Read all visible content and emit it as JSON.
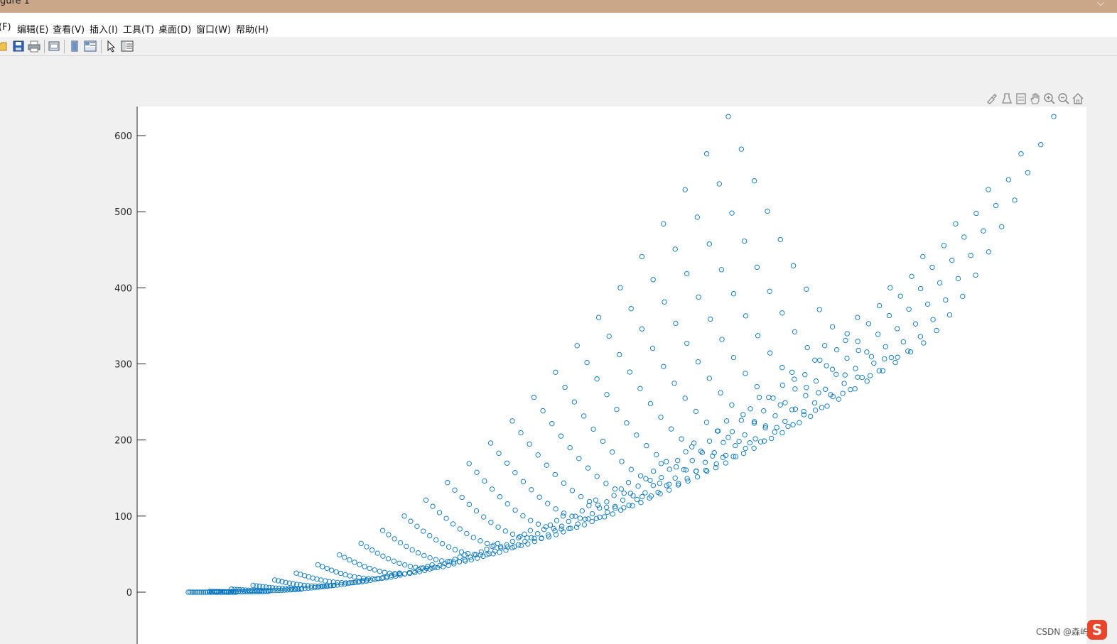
{
  "window": {
    "title": "gure 1"
  },
  "menu": [
    {
      "label": "(F)"
    },
    {
      "label": "编辑(E)"
    },
    {
      "label": "查看(V)"
    },
    {
      "label": "插入(I)"
    },
    {
      "label": "工具(T)"
    },
    {
      "label": "桌面(D)"
    },
    {
      "label": "窗口(W)"
    },
    {
      "label": "帮助(H)"
    }
  ],
  "toolbar": [
    {
      "icon": "open-file-icon"
    },
    {
      "icon": "save-icon"
    },
    {
      "icon": "print-icon"
    },
    {
      "icon": "print-preview-icon"
    },
    {
      "icon": "hide-plot-tools-icon"
    },
    {
      "icon": "show-plot-tools-icon"
    },
    {
      "icon": "edit-plot-arrow-icon"
    },
    {
      "icon": "property-inspector-icon"
    }
  ],
  "axes_toolbar": [
    {
      "icon": "brush-icon"
    },
    {
      "icon": "data-tips-icon"
    },
    {
      "icon": "restore-view-icon"
    },
    {
      "icon": "pan-hand-icon"
    },
    {
      "icon": "zoom-in-icon"
    },
    {
      "icon": "zoom-out-icon"
    },
    {
      "icon": "home-icon"
    }
  ],
  "watermark": {
    "text": "CSDN @森屿"
  },
  "colors": {
    "marker": "#0072bd",
    "axes_bg": "#ffffff",
    "figure_bg": "#f0f0f0",
    "titlebar": "#c9a788"
  },
  "chart_data": {
    "type": "scatter",
    "marker": "open-circle",
    "title": "",
    "xlabel": "",
    "ylabel": "",
    "ylim": [
      -70,
      660
    ],
    "yticks": [
      0,
      100,
      200,
      300,
      400,
      500,
      600
    ],
    "grid": false,
    "x_tick_labels_visible": false,
    "description_of_data": "curve family y(t) = 625*(t/25)^2 (upper arm) and x(t) = a*k + (-0.7*t^2 + ... ) sampled for k = 1..25, each curve sampled at 25 points",
    "series": [
      {
        "values_rule": "for k in 1..25, t in 0..25: x = 15*t*t/25 - 10*t*k/25 + 2*k*k/25 (arbitrary units), y = t*t + k*k*0 (data units on y-axis 0..625)",
        "y_range": [
          0,
          625
        ]
      }
    ]
  }
}
